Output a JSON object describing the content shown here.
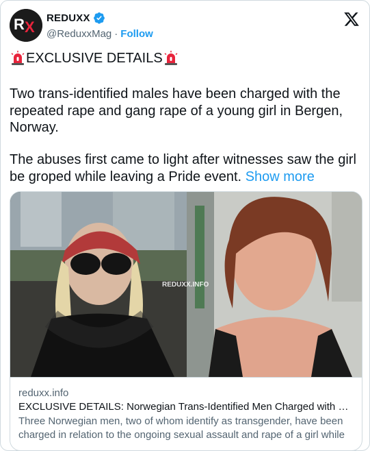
{
  "account": {
    "display_name": "REDUXX",
    "handle": "@ReduxxMag",
    "separator": "·",
    "follow_label": "Follow",
    "avatar_text": "RX"
  },
  "tweet": {
    "headline": "EXCLUSIVE DETAILS",
    "paragraph1": "Two trans-identified males have been charged with the repeated rape and gang rape of a young girl in Bergen, Norway.",
    "paragraph2": "The abuses first came to light after witnesses saw the girl be groped while leaving a Pride event.",
    "show_more_label": "Show more"
  },
  "card": {
    "watermark": "REDUXX.INFO",
    "domain": "reduxx.info",
    "title": "EXCLUSIVE DETAILS: Norwegian Trans-Identified Men Charged with Gang Rape of Girl",
    "description": "Three Norwegian men, two of whom identify as transgender, have been charged in relation to the ongoing sexual assault and rape of a girl while attending events."
  },
  "icons": {
    "verified": "verified-badge-icon",
    "platform": "x-logo-icon",
    "siren": "police-light-emoji"
  },
  "colors": {
    "link": "#1d9bf0",
    "secondary_text": "#536471",
    "border": "#cfd9de",
    "siren_red": "#e8243c"
  }
}
